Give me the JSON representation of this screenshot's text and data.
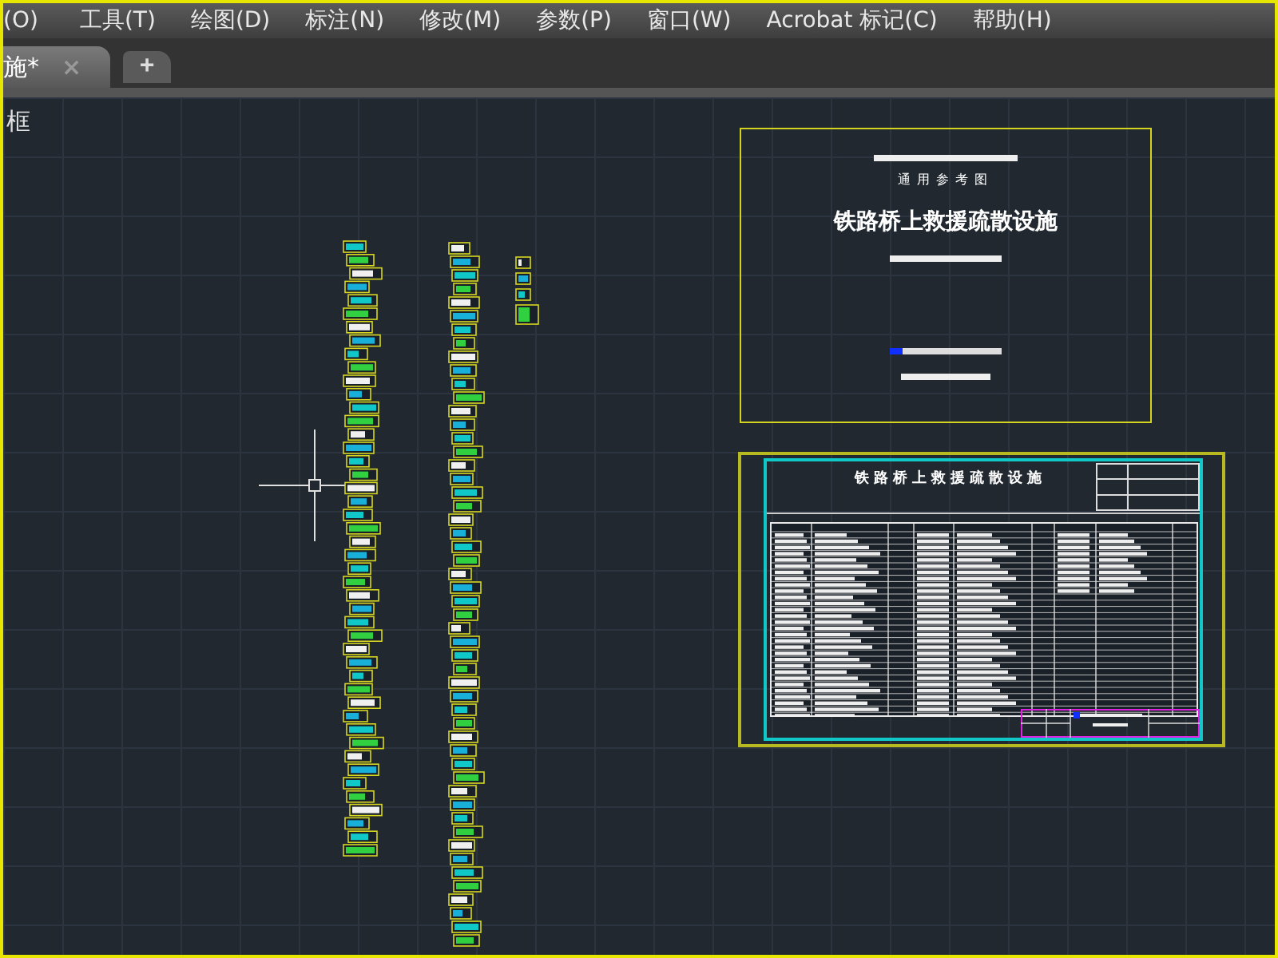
{
  "menu_bar": {
    "items": [
      "(O)",
      "工具(T)",
      "绘图(D)",
      "标注(N)",
      "修改(M)",
      "参数(P)",
      "窗口(W)",
      "Acrobat 标记(C)",
      "帮助(H)"
    ]
  },
  "tabs": [
    {
      "label": "施*",
      "close": "×",
      "selected": true
    }
  ],
  "new_tab_button": "+",
  "viewport_label": "框",
  "cover_sheet": {
    "subtitle": "通用参考图",
    "title": "铁路桥上救援疏散设施"
  },
  "index_sheet": {
    "title": "铁路桥上救援疏散设施"
  }
}
